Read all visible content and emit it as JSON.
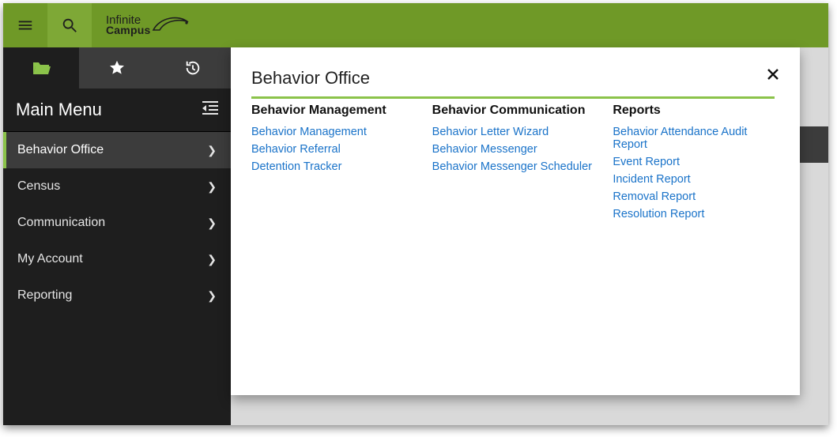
{
  "brand": {
    "line1": "Infinite",
    "line2": "Campus"
  },
  "sidebar": {
    "title": "Main Menu",
    "items": [
      {
        "label": "Behavior Office",
        "active": true
      },
      {
        "label": "Census"
      },
      {
        "label": "Communication"
      },
      {
        "label": "My Account"
      },
      {
        "label": "Reporting"
      }
    ]
  },
  "panel": {
    "title": "Behavior Office",
    "columns": [
      {
        "heading": "Behavior Management",
        "links": [
          "Behavior Management",
          "Behavior Referral",
          "Detention Tracker"
        ]
      },
      {
        "heading": "Behavior Communication",
        "links": [
          "Behavior Letter Wizard",
          "Behavior Messenger",
          "Behavior Messenger Scheduler"
        ]
      },
      {
        "heading": "Reports",
        "links": [
          "Behavior Attendance Audit Report",
          "Event Report",
          "Incident Report",
          "Removal Report",
          "Resolution Report"
        ]
      }
    ]
  }
}
